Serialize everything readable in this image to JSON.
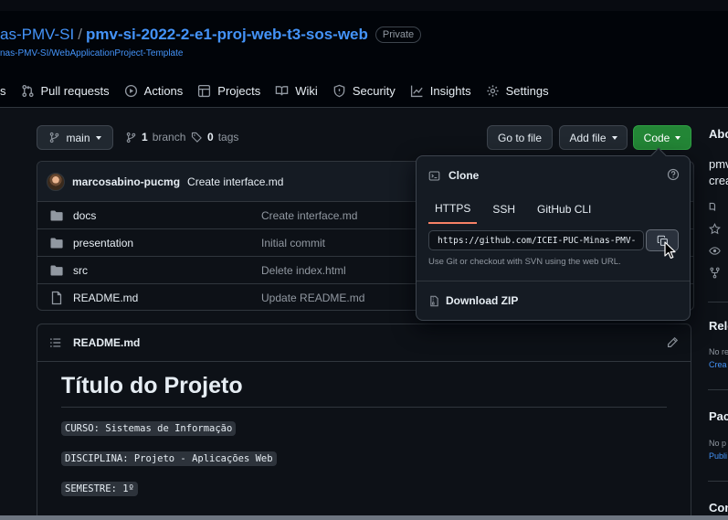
{
  "repo": {
    "owner": "as-PMV-SI",
    "separator": "/",
    "name": "pmv-si-2022-2-e1-proj-web-t3-sos-web",
    "visibility": "Private",
    "template": "nas-PMV-SI/WebApplicationProject-Template"
  },
  "nav": {
    "first_partial": "s",
    "items": [
      {
        "label": "Pull requests",
        "icon": "pull-request-icon"
      },
      {
        "label": "Actions",
        "icon": "play-icon"
      },
      {
        "label": "Projects",
        "icon": "table-icon"
      },
      {
        "label": "Wiki",
        "icon": "book-icon"
      },
      {
        "label": "Security",
        "icon": "shield-icon"
      },
      {
        "label": "Insights",
        "icon": "graph-icon"
      },
      {
        "label": "Settings",
        "icon": "gear-icon"
      }
    ]
  },
  "toolbar": {
    "branch": "main",
    "branches_count": "1",
    "branches_label": "branch",
    "tags_count": "0",
    "tags_label": "tags",
    "go_to_file": "Go to file",
    "add_file": "Add file",
    "code": "Code"
  },
  "latest_commit": {
    "author": "marcosabino-pucmg",
    "message": "Create interface.md"
  },
  "files": [
    {
      "name": "docs",
      "type": "folder",
      "commit": "Create interface.md"
    },
    {
      "name": "presentation",
      "type": "folder",
      "commit": "Initial commit"
    },
    {
      "name": "src",
      "type": "folder",
      "commit": "Delete index.html"
    },
    {
      "name": "README.md",
      "type": "file",
      "commit": "Update README.md"
    }
  ],
  "readme": {
    "filename": "README.md",
    "title": "Título do Projeto",
    "lines": [
      "CURSO: Sistemas de Informação",
      "DISCIPLINA: Projeto - Aplicações Web",
      "SEMESTRE: 1º"
    ]
  },
  "clone": {
    "title": "Clone",
    "tabs": [
      "HTTPS",
      "SSH",
      "GitHub CLI"
    ],
    "active_tab": "HTTPS",
    "url": "https://github.com/ICEI-PUC-Minas-PMV-",
    "hint": "Use Git or checkout with SVN using the web URL.",
    "download": "Download ZIP"
  },
  "sidebar": {
    "about": "Abo",
    "desc1": "pmv",
    "desc2": "crea",
    "releases": "Rele",
    "releases_note": "No re",
    "releases_link": "Crea",
    "packages": "Pac",
    "packages_note": "No p",
    "packages_link": "Publi",
    "contributors": "Con"
  },
  "colors": {
    "accent_link": "#4493f8",
    "code_button": "#238636",
    "active_tab_underline": "#f78166",
    "background": "#0d1117"
  }
}
